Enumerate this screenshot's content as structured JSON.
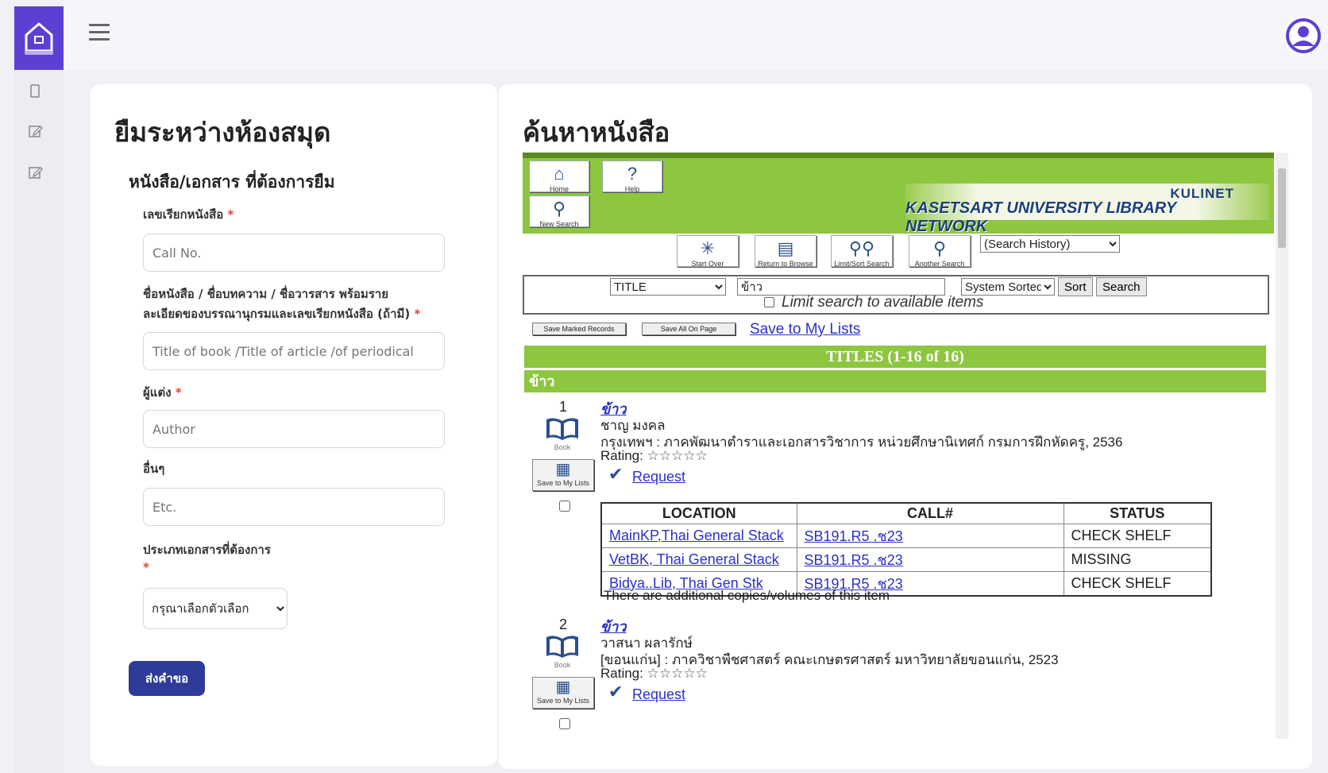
{
  "left_panel": {
    "title": "ยืมระหว่างห้องสมุด",
    "subtitle": "หนังสือ/เอกสาร ที่ต้องการยืม",
    "call_no": {
      "label": "เลขเรียกหนังสือ",
      "placeholder": "Call No."
    },
    "title_field": {
      "label_line1": "ชื่อหนังสือ / ชื่อบทความ / ชื่อวารสาร พร้อมราย",
      "label_line2": "ละเอียดของบรรณานุกรมและเลขเรียกหนังสือ (ถ้ามี)",
      "placeholder": "Title of book /Title of article /of periodical"
    },
    "author": {
      "label": "ผู้แต่ง",
      "placeholder": "Author"
    },
    "etc": {
      "label": "อื่นๆ",
      "placeholder": "Etc."
    },
    "doc_type": {
      "label": "ประเภทเอกสารที่ต้องการ",
      "selected": "กรุณาเลือกตัวเลือก"
    },
    "required_mark": "*",
    "submit_label": "ส่งคำขอ"
  },
  "right_panel": {
    "title": "ค้นหาหนังสือ",
    "opac": {
      "toolbar": {
        "home": "Home",
        "help": "Help",
        "new_search": "New Search"
      },
      "banner": {
        "kulinet": "KULINET",
        "name": "KASETSART UNIVERSITY LIBRARY NETWORK"
      },
      "nav": {
        "start_over": "Start Over",
        "return_browse": "Return to Browse",
        "limit_sort": "Limit/Sort Search",
        "another": "Another Search",
        "history": "(Search History)"
      },
      "search": {
        "index": "TITLE",
        "term": "ข้าว",
        "sort": "System Sorted",
        "sort_btn": "Sort",
        "search_btn": "Search",
        "limit_label": "Limit search to available items"
      },
      "actions": {
        "save_marked": "Save Marked Records",
        "save_all": "Save All On Page",
        "save_lists": "Save to My Lists"
      },
      "titles_bar": "TITLES (1-16 of 16)",
      "keyword": "ข้าว",
      "records": [
        {
          "num": "1",
          "title": "ข้าว",
          "author": "ชาญ มงคล",
          "pub": "กรุงเทพฯ : ภาคพัฒนาตำราและเอกสารวิชาการ หน่วยศึกษานิเทศก์ กรมการฝึกหัดครู, 2536",
          "rating_label": "Rating:",
          "stars": "☆☆☆☆☆",
          "request": "Request",
          "book_label": "Book",
          "save_label": "Save to My Lists"
        },
        {
          "num": "2",
          "title": "ข้าว",
          "author": "วาสนา ผลารักษ์",
          "pub": "[ขอนแก่น] : ภาควิชาพืชศาสตร์ คณะเกษตรศาสตร์ มหาวิทยาลัยขอนแก่น, 2523",
          "rating_label": "Rating:",
          "stars": "☆☆☆☆☆",
          "request": "Request",
          "book_label": "Book",
          "save_label": "Save to My Lists"
        }
      ],
      "holdings": {
        "headers": [
          "LOCATION",
          "CALL#",
          "STATUS"
        ],
        "rows": [
          [
            "MainKP,Thai General Stack",
            "SB191.R5 .ช23",
            "CHECK SHELF"
          ],
          [
            "VetBK, Thai General Stack",
            "SB191.R5 .ช23",
            "MISSING"
          ],
          [
            "Bidya..Lib, Thai Gen Stk",
            "SB191.R5 .ช23",
            "CHECK SHELF"
          ]
        ],
        "note": "There are additional copies/volumes of this item"
      }
    }
  },
  "colors": {
    "accent": "#5d3fd3",
    "submit": "#2e3b99",
    "opac_green": "#8dc63f",
    "link": "#2a31c8"
  }
}
